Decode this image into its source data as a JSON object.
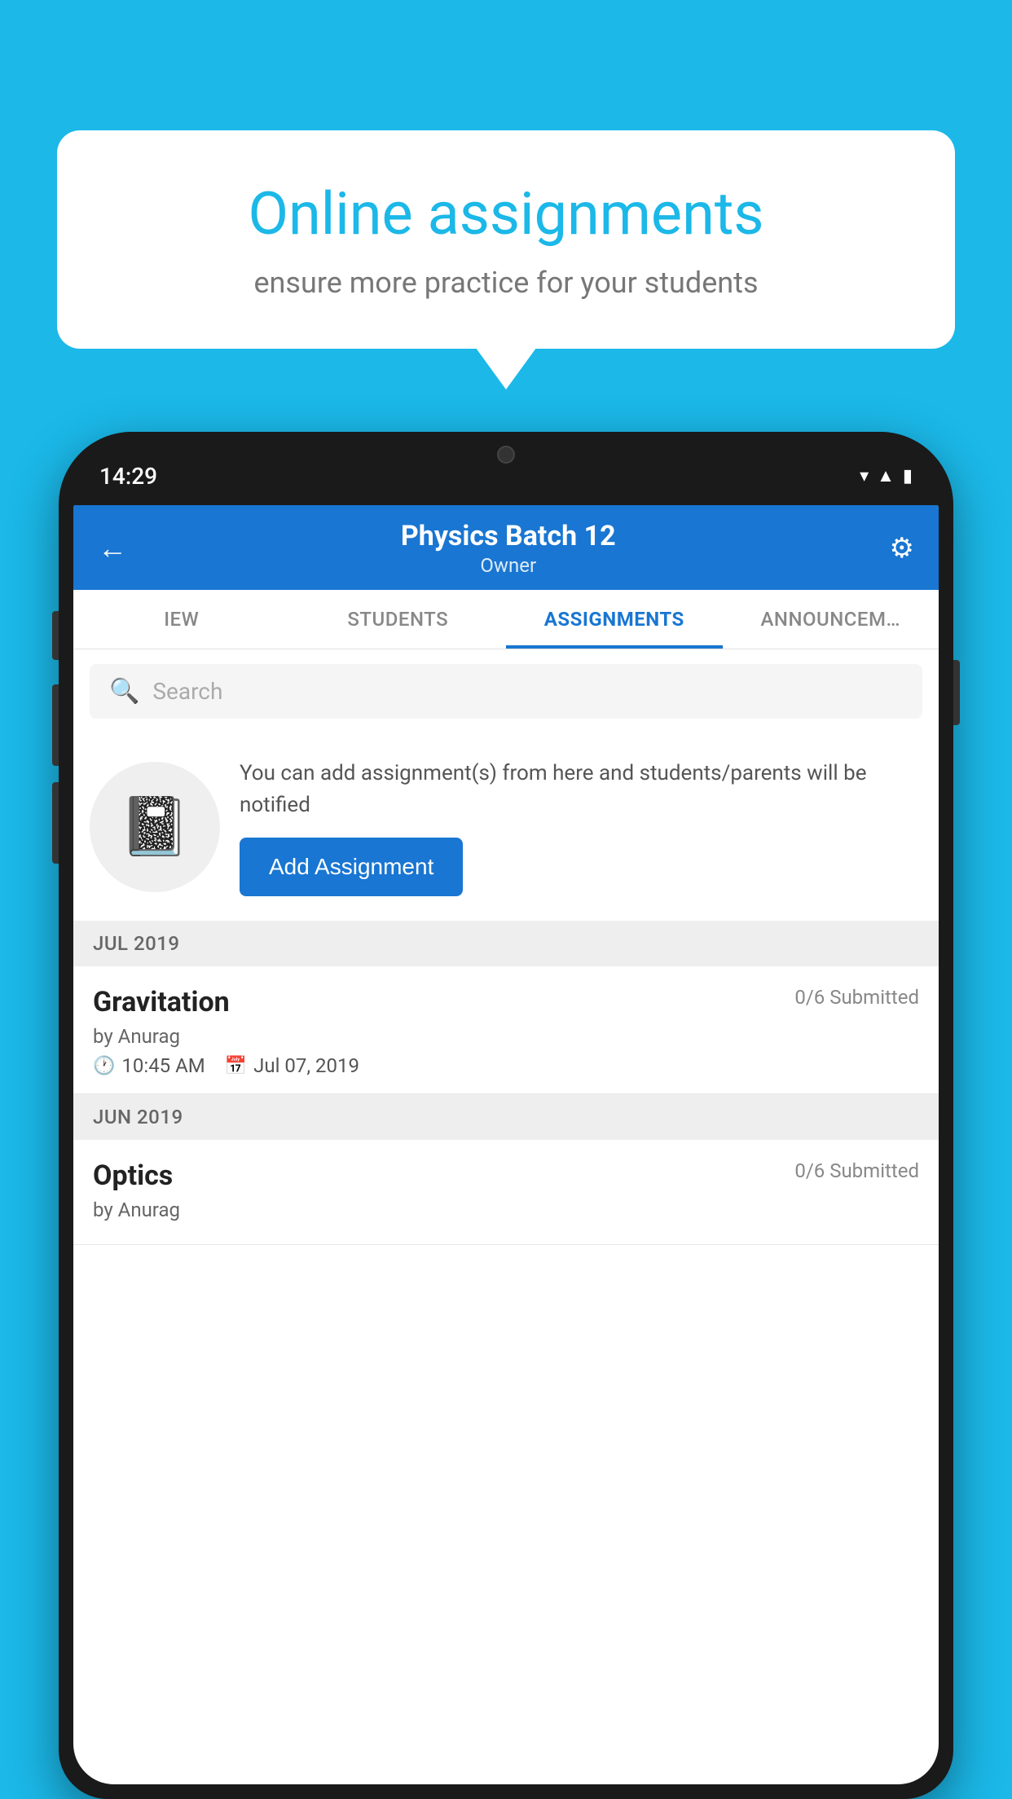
{
  "background_color": "#1BB8E8",
  "speech_bubble": {
    "title": "Online assignments",
    "subtitle": "ensure more practice for your students"
  },
  "phone": {
    "status_bar": {
      "time": "14:29"
    },
    "header": {
      "title": "Physics Batch 12",
      "subtitle": "Owner",
      "back_label": "←",
      "settings_label": "⚙"
    },
    "tabs": [
      {
        "label": "IEW",
        "active": false
      },
      {
        "label": "STUDENTS",
        "active": false
      },
      {
        "label": "ASSIGNMENTS",
        "active": true
      },
      {
        "label": "ANNOUNCEM…",
        "active": false
      }
    ],
    "search": {
      "placeholder": "Search"
    },
    "promo": {
      "text": "You can add assignment(s) from here and students/parents will be notified",
      "button_label": "Add Assignment"
    },
    "sections": [
      {
        "label": "JUL 2019",
        "assignments": [
          {
            "title": "Gravitation",
            "submitted": "0/6 Submitted",
            "author": "by Anurag",
            "time": "10:45 AM",
            "date": "Jul 07, 2019"
          }
        ]
      },
      {
        "label": "JUN 2019",
        "assignments": [
          {
            "title": "Optics",
            "submitted": "0/6 Submitted",
            "author": "by Anurag",
            "time": "",
            "date": ""
          }
        ]
      }
    ]
  }
}
